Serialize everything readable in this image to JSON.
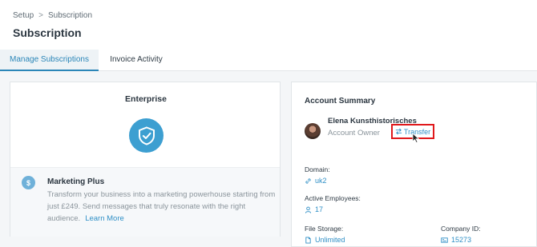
{
  "breadcrumb": {
    "parent": "Setup",
    "separator": ">",
    "current": "Subscription"
  },
  "page": {
    "title": "Subscription"
  },
  "tabs": [
    {
      "label": "Manage Subscriptions",
      "active": true
    },
    {
      "label": "Invoice Activity",
      "active": false
    }
  ],
  "plan": {
    "name": "Enterprise",
    "icon": "shield-check-icon"
  },
  "addon": {
    "icon": "dollar-icon",
    "title": "Marketing Plus",
    "description": "Transform your business into a marketing powerhouse starting from just £249. Send messages that truly resonate with the right audience.",
    "learn_more": "Learn More"
  },
  "account_summary": {
    "title": "Account Summary",
    "owner_name": "Elena Kunsthistorisches",
    "owner_role": "Account Owner",
    "transfer_label": "Transfer",
    "domain_label": "Domain:",
    "domain_value": "uk2",
    "employees_label": "Active Employees:",
    "employees_value": "17",
    "storage_label": "File Storage:",
    "storage_value": "Unlimited",
    "company_id_label": "Company ID:",
    "company_id_value": "15273"
  },
  "colors": {
    "accent": "#2f8fc6",
    "highlight": "#e0191c",
    "shield": "#3d9fd1"
  }
}
